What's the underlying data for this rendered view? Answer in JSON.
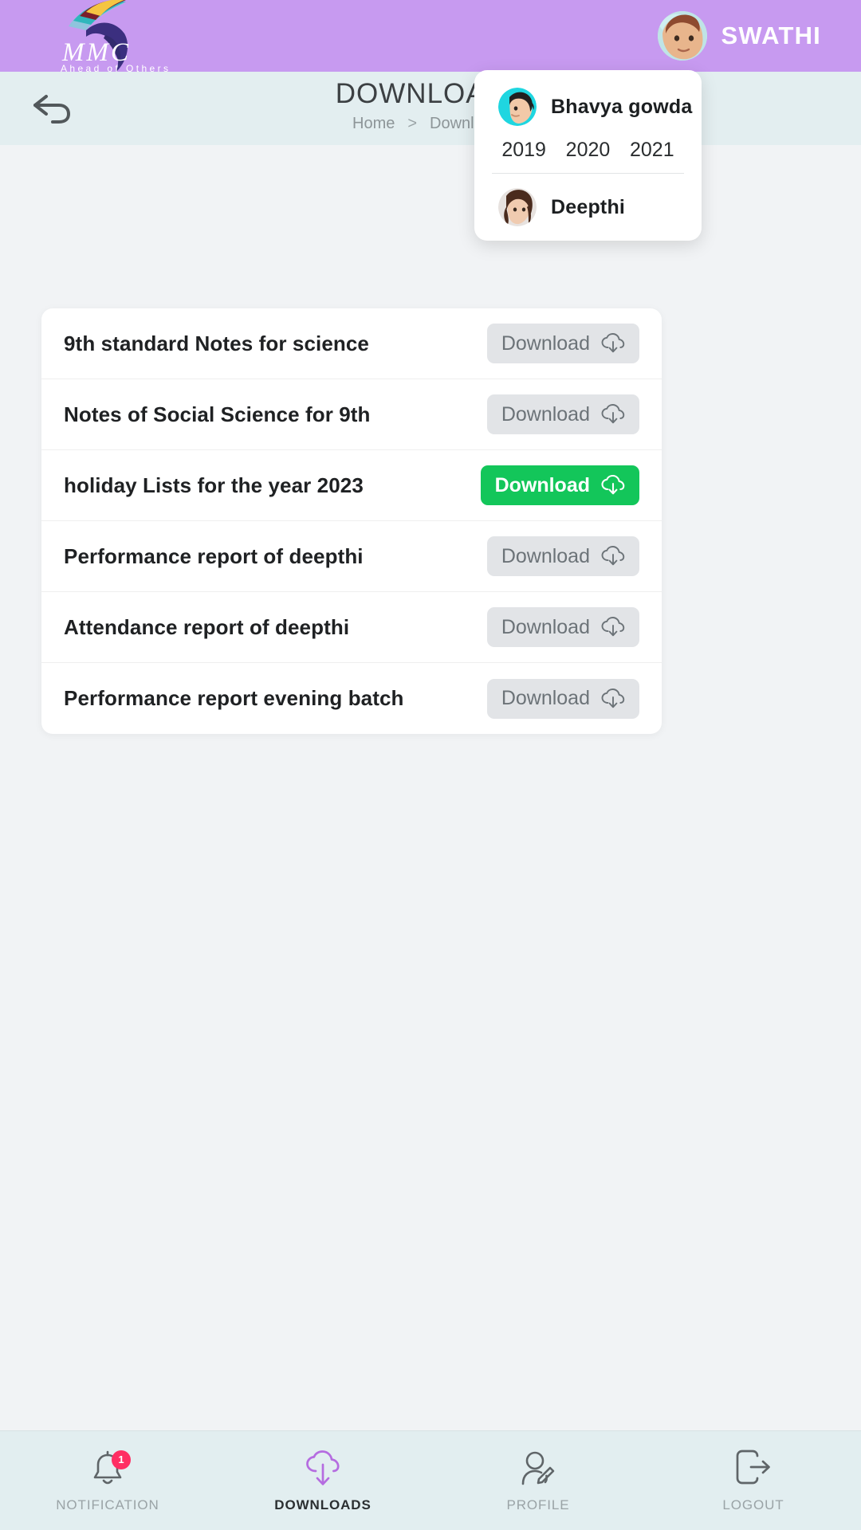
{
  "brand": {
    "logo_initials": "MMC",
    "logo_tagline": "Ahead of Others"
  },
  "header": {
    "user_name": "SWATHI",
    "avatar_name": "swathi-avatar"
  },
  "titlebar": {
    "back_icon": "back-arrow-icon",
    "title": "DOWNLOADS",
    "breadcrumb_home": "Home",
    "breadcrumb_separator": ">",
    "breadcrumb_current": "Downloads"
  },
  "student_panel": {
    "students": [
      {
        "name": "Bhavya gowda",
        "years": [
          "2019",
          "2020",
          "2021"
        ]
      },
      {
        "name": "Deepthi",
        "years": []
      }
    ]
  },
  "downloads": {
    "button_label": "Download",
    "button_icon": "cloud-download-icon",
    "items": [
      {
        "title": "9th standard Notes for science",
        "state": "inactive"
      },
      {
        "title": "Notes of Social Science for 9th",
        "state": "inactive"
      },
      {
        "title": "holiday Lists for the year 2023",
        "state": "active"
      },
      {
        "title": "Performance report of deepthi",
        "state": "inactive"
      },
      {
        "title": "Attendance report of deepthi",
        "state": "inactive"
      },
      {
        "title": "Performance report evening batch",
        "state": "inactive"
      }
    ]
  },
  "bottom_nav": {
    "items": [
      {
        "label": "NOTIFICATION",
        "icon": "bell-icon",
        "badge": "1",
        "active": false
      },
      {
        "label": "DOWNLOADS",
        "icon": "cloud-download-icon",
        "badge": "",
        "active": true
      },
      {
        "label": "PROFILE",
        "icon": "user-edit-icon",
        "badge": "",
        "active": false
      },
      {
        "label": "LOGOUT",
        "icon": "logout-icon",
        "badge": "",
        "active": false
      }
    ]
  },
  "colors": {
    "brand_bar": "#c79af0",
    "title_bar": "#e3eef0",
    "active_green": "#13c65a",
    "badge_red": "#ff2e63",
    "nav_accent": "#b56ce0"
  }
}
